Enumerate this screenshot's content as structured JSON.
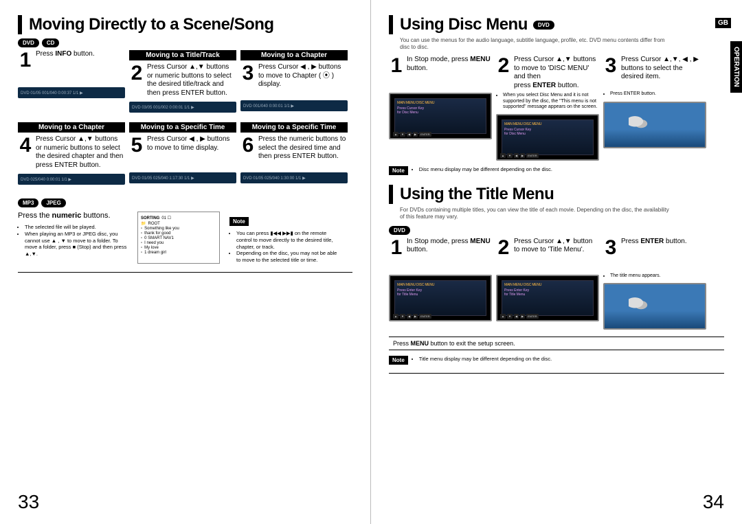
{
  "global": {
    "lang_badge": "GB",
    "side_label": "OPERATION",
    "page_left": "33",
    "page_right": "34",
    "note_label": "Note"
  },
  "left": {
    "title": "Moving Directly to a Scene/Song",
    "badges_top": [
      "DVD",
      "CD"
    ],
    "row1": {
      "s1": {
        "num": "1",
        "text_pre": "Press ",
        "text_b": "INFO",
        "text_post": " button."
      },
      "s2": {
        "sub": "Moving to a Title/Track",
        "num": "2",
        "text": "Press Cursor ▲,▼ buttons or numeric buttons to select the desired title/track and then press ENTER button."
      },
      "s3": {
        "sub": "Moving to a Chapter",
        "num": "3",
        "text": "Press Cursor ◀ , ▶ buttons to move to Chapter ( ⦿ ) display."
      }
    },
    "osd1": {
      "a": "DVD  01/05  001/040  0:00:37  1/1 ▶",
      "b": "DVD  03/05  001/002  0:00:01  1/1 ▶",
      "c": "DVD  001/040  0:00:01  1/1 ▶"
    },
    "row2": {
      "s4": {
        "sub": "Moving to a Chapter",
        "num": "4",
        "text": "Press Cursor ▲,▼ buttons or numeric buttons to select the desired chapter and then press ENTER button."
      },
      "s5": {
        "sub": "Moving to a Specific Time",
        "num": "5",
        "text": "Press Cursor ◀ , ▶ buttons to move to time display."
      },
      "s6": {
        "sub": "Moving to a Specific Time",
        "num": "6",
        "text": "Press the numeric buttons to select the desired time and then press ENTER button."
      }
    },
    "osd2": {
      "a": "DVD  025/040  0:00:01  1/1 ▶",
      "b": "DVD  01/05  025/040  1:17:30  1/1 ▶",
      "c": "DVD  01/05  025/040  1:30:00  1/1 ▶"
    },
    "mp3": {
      "badges": [
        "MP3",
        "JPEG"
      ],
      "instr_pre": "Press the ",
      "instr_b": "numeric",
      "instr_post": " buttons.",
      "sortbox_title": "SORTING",
      "sortbox_repeat": "01 ☐",
      "sortbox_root": "ROOT",
      "sortbox_files": [
        "Something like you",
        "thank for good",
        "0 SMART NAV1",
        "I need you",
        "My love",
        "1 dream girl"
      ],
      "bullets": [
        "The selected file will be played.",
        "When playing an MP3 or JPEG disc, you cannot use ▲ , ▼ to move to a folder. To move a folder, press ■ (Stop) and then press ▲,▼."
      ],
      "note_bullets": [
        "You can press ▮◀◀ ▶▶▮ on the remote control to move directly to the desired title, chapter, or track.",
        "Depending on the disc, you may not be able to move to the selected title or time."
      ]
    }
  },
  "right": {
    "disc": {
      "title": "Using Disc Menu",
      "badge": "DVD",
      "intro": "You can use the menus for the audio language, subtitle language, profile, etc. DVD menu contents differ from disc to disc.",
      "s1": {
        "num": "1",
        "text_pre": "In Stop mode, press ",
        "text_b": "MENU",
        "text_post": " button."
      },
      "s2": {
        "num": "2",
        "line1": "Press Cursor ▲,▼ buttons to move to 'DISC MENU' and then",
        "line2_pre": "press ",
        "line2_b": "ENTER",
        "line2_post": " button."
      },
      "s2_note": "When you select Disc Menu and it is not supported by the disc, the \"This menu is not supported\" message appears on the screen.",
      "s3": {
        "num": "3",
        "text": "Press Cursor ▲,▼, ◀ , ▶ buttons to select the desired item."
      },
      "s3_note": "Press ENTER button.",
      "screen_menu_hdr": "MAIN MENU            DISC MENU",
      "screen_menu_l1": "Press Cursor Key",
      "screen_menu_l2": "for Disc Menu",
      "note_line": "Disc menu display may be different depending on the disc."
    },
    "titlemenu": {
      "title": "Using the Title Menu",
      "intro": "For DVDs containing multiple titles, you can view the title of each movie. Depending on the disc, the availability of this feature may vary.",
      "badge": "DVD",
      "s1": {
        "num": "1",
        "text_pre": "In Stop mode, press ",
        "text_b": "MENU",
        "text_post": " button."
      },
      "s2": {
        "num": "2",
        "text": "Press Cursor ▲,▼ button to move to 'Title Menu'."
      },
      "s3": {
        "num": "3",
        "text_pre": "Press ",
        "text_b": "ENTER",
        "text_post": " button."
      },
      "s3_note": "The title menu appears.",
      "screen_menu_l1": "Press Enter Key",
      "screen_menu_l2": "for Title Menu",
      "exit_pre": "Press ",
      "exit_b": "MENU",
      "exit_post": " button to exit the setup screen.",
      "note_line": "Title menu display may be different depending on the disc."
    }
  }
}
